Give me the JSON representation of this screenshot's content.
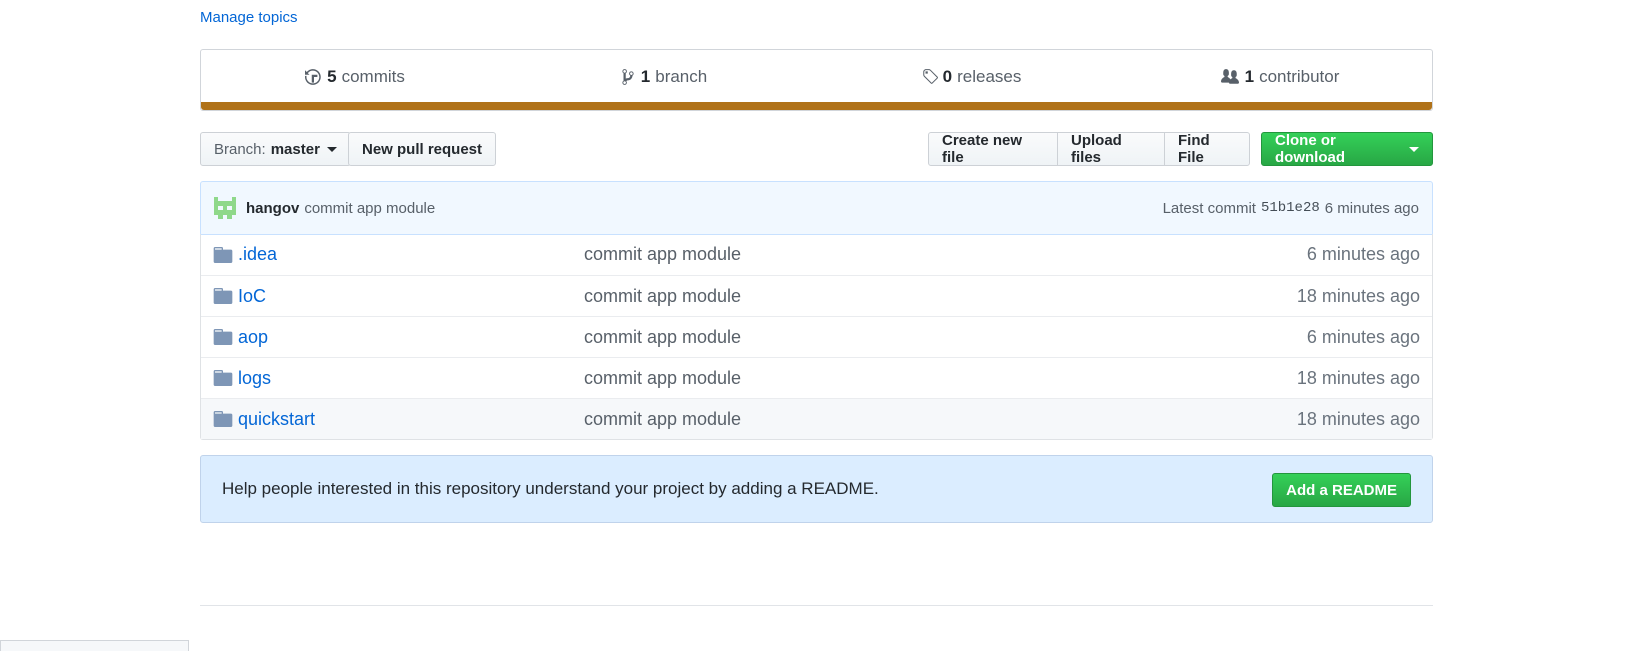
{
  "repo": {
    "manage_topics": "Manage topics"
  },
  "summary": {
    "commits": {
      "count": "5",
      "label": "commits",
      "icon": "history-icon"
    },
    "branches": {
      "count": "1",
      "label": "branch",
      "icon": "git-branch-icon"
    },
    "releases": {
      "count": "0",
      "label": "releases",
      "icon": "tag-icon"
    },
    "contributors": {
      "count": "1",
      "label": "contributor",
      "icon": "people-icon"
    },
    "language_color": "#b07219"
  },
  "toolbar": {
    "branch_prefix": "Branch:",
    "branch_name": "master",
    "new_pull_request": "New pull request",
    "create_new_file": "Create new file",
    "upload_files": "Upload files",
    "find_file": "Find File",
    "clone_or_download": "Clone or download"
  },
  "latest_commit": {
    "author": "hangov",
    "message": "commit app module",
    "prefix": "Latest commit",
    "sha": "51b1e28",
    "age": "6 minutes ago"
  },
  "files": [
    {
      "name": ".idea",
      "message": "commit app module",
      "age": "6 minutes ago"
    },
    {
      "name": "IoC",
      "message": "commit app module",
      "age": "18 minutes ago"
    },
    {
      "name": "aop",
      "message": "commit app module",
      "age": "6 minutes ago"
    },
    {
      "name": "logs",
      "message": "commit app module",
      "age": "18 minutes ago"
    },
    {
      "name": "quickstart",
      "message": "commit app module",
      "age": "18 minutes ago"
    }
  ],
  "readme_prompt": {
    "text": "Help people interested in this repository understand your project by adding a README.",
    "button": "Add a README"
  }
}
